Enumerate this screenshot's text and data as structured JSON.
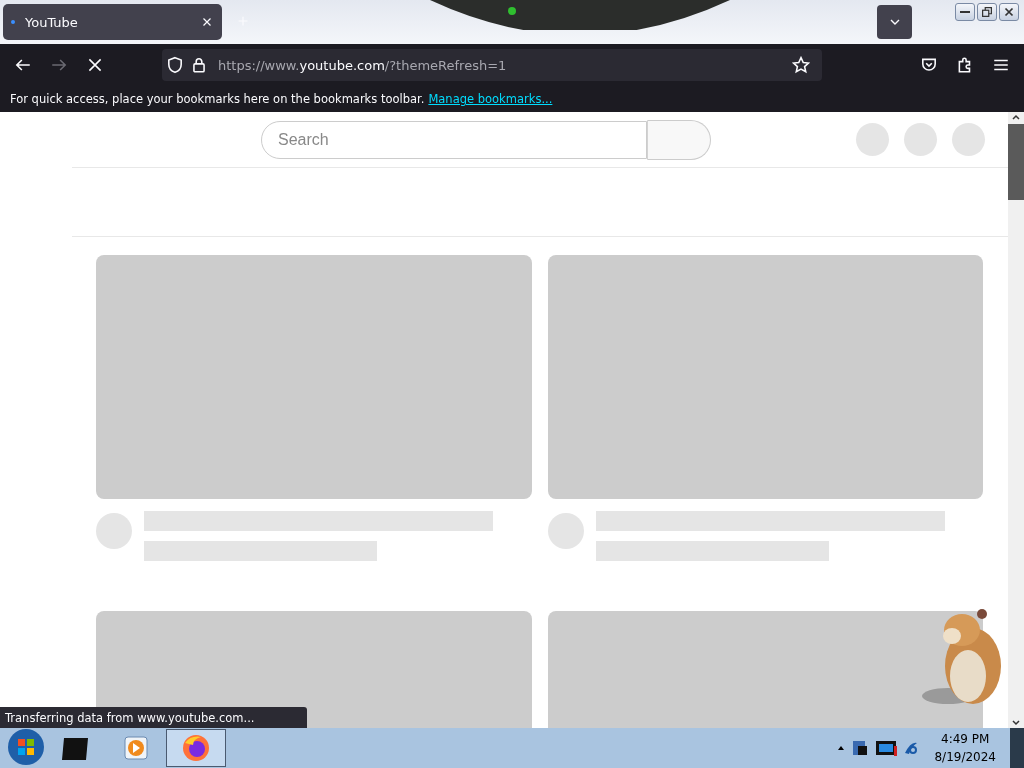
{
  "browser": {
    "tab": {
      "title": "YouTube",
      "selected": true
    },
    "address": "https://www.**youtube.com**/?themeRefresh=1",
    "bookmarks_bar": {
      "message": "For quick access, place your bookmarks here on the bookmarks toolbar.",
      "link": "Manage bookmarks..."
    }
  },
  "page": {
    "search": {
      "placeholder": "Search"
    }
  },
  "status": "Transferring data from www.youtube.com...",
  "taskbar": {
    "time": "4:49 PM",
    "date": "8/19/2024"
  }
}
